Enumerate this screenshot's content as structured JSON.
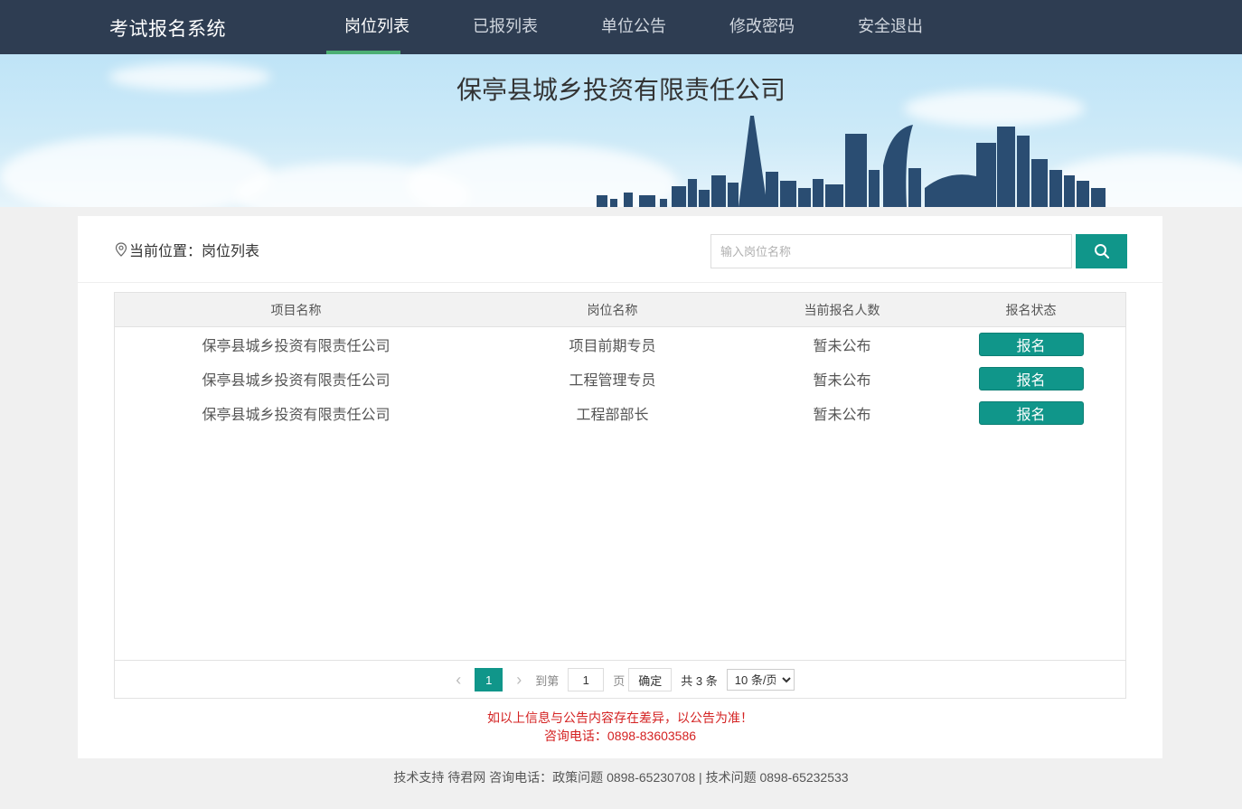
{
  "header": {
    "brand": "考试报名系统",
    "nav": [
      {
        "label": "岗位列表",
        "active": true
      },
      {
        "label": "已报列表",
        "active": false
      },
      {
        "label": "单位公告",
        "active": false
      },
      {
        "label": "修改密码",
        "active": false
      },
      {
        "label": "安全退出",
        "active": false
      }
    ]
  },
  "banner": {
    "title": "保亭县城乡投资有限责任公司"
  },
  "breadcrumb": {
    "label": "当前位置：岗位列表"
  },
  "search": {
    "placeholder": "输入岗位名称",
    "icon": "search-icon"
  },
  "table": {
    "headers": [
      "项目名称",
      "岗位名称",
      "当前报名人数",
      "报名状态"
    ],
    "rows": [
      {
        "project": "保亭县城乡投资有限责任公司",
        "position": "项目前期专员",
        "count": "暂未公布",
        "action": "报名"
      },
      {
        "project": "保亭县城乡投资有限责任公司",
        "position": "工程管理专员",
        "count": "暂未公布",
        "action": "报名"
      },
      {
        "project": "保亭县城乡投资有限责任公司",
        "position": "工程部部长",
        "count": "暂未公布",
        "action": "报名"
      }
    ]
  },
  "pager": {
    "current": "1",
    "goto_label": "到第",
    "page_input": "1",
    "page_unit": "页",
    "confirm": "确定",
    "total": "共 3 条",
    "page_size": "10 条/页"
  },
  "notice": {
    "line1": "如以上信息与公告内容存在差异，以公告为准！",
    "line2": "咨询电话：0898-83603586"
  },
  "footer": {
    "text": "技术支持 待君网 咨询电话：政策问题 0898-65230708 | 技术问题 0898-65232533"
  },
  "colors": {
    "nav_bg": "#2e3d52",
    "accent": "#10968a",
    "nav_active_underline": "#4caf74",
    "notice": "#d42222"
  }
}
